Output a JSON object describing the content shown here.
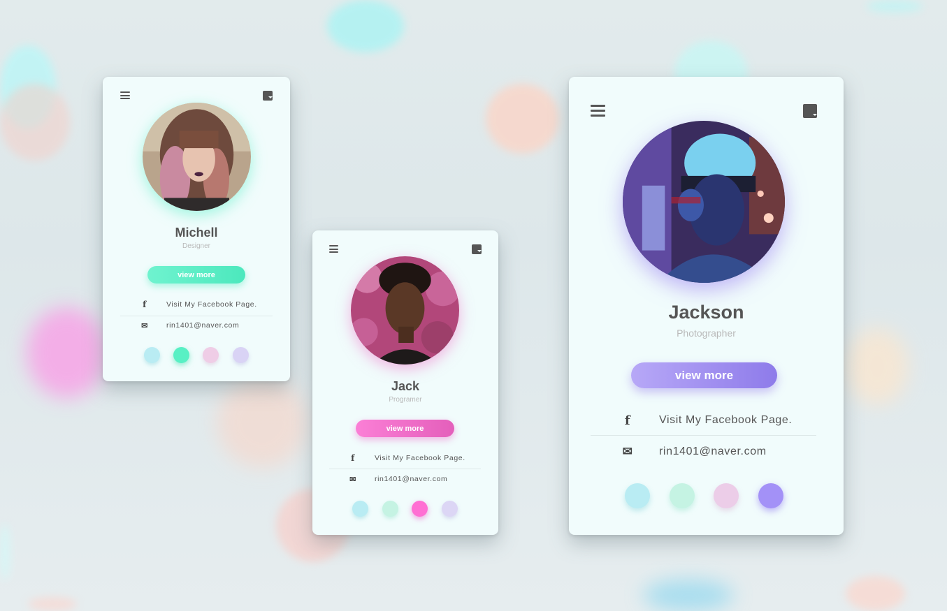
{
  "cards": [
    {
      "name": "Michell",
      "role": "Designer",
      "button_label": "view more",
      "facebook_label": "Visit My Facebook Page.",
      "email": "rin1401@naver.com",
      "accent": "#5cf0c8",
      "dots": [
        "#b9ecf3",
        "#58f0c4",
        "#efcde6",
        "#d9d3f5"
      ],
      "selected_dot": 1
    },
    {
      "name": "Jack",
      "role": "Programer",
      "button_label": "view more",
      "facebook_label": "Visit My Facebook Page.",
      "email": "rin1401@naver.com",
      "accent": "#f06ec9",
      "dots": [
        "#b9ecf3",
        "#c5f3e3",
        "#ff6fd3",
        "#dcd6f5"
      ],
      "selected_dot": 2
    },
    {
      "name": "Jackson",
      "role": "Photographer",
      "button_label": "view more",
      "facebook_label": "Visit My Facebook Page.",
      "email": "rin1401@naver.com",
      "accent": "#9a86ee",
      "dots": [
        "#b9ecf3",
        "#c5f3e3",
        "#eccde8",
        "#a391f7"
      ],
      "selected_dot": 3
    }
  ],
  "icons": {
    "menu": "hamburger-menu-icon",
    "note": "sticky-note-icon",
    "facebook": "facebook-icon",
    "email": "envelope-icon"
  }
}
